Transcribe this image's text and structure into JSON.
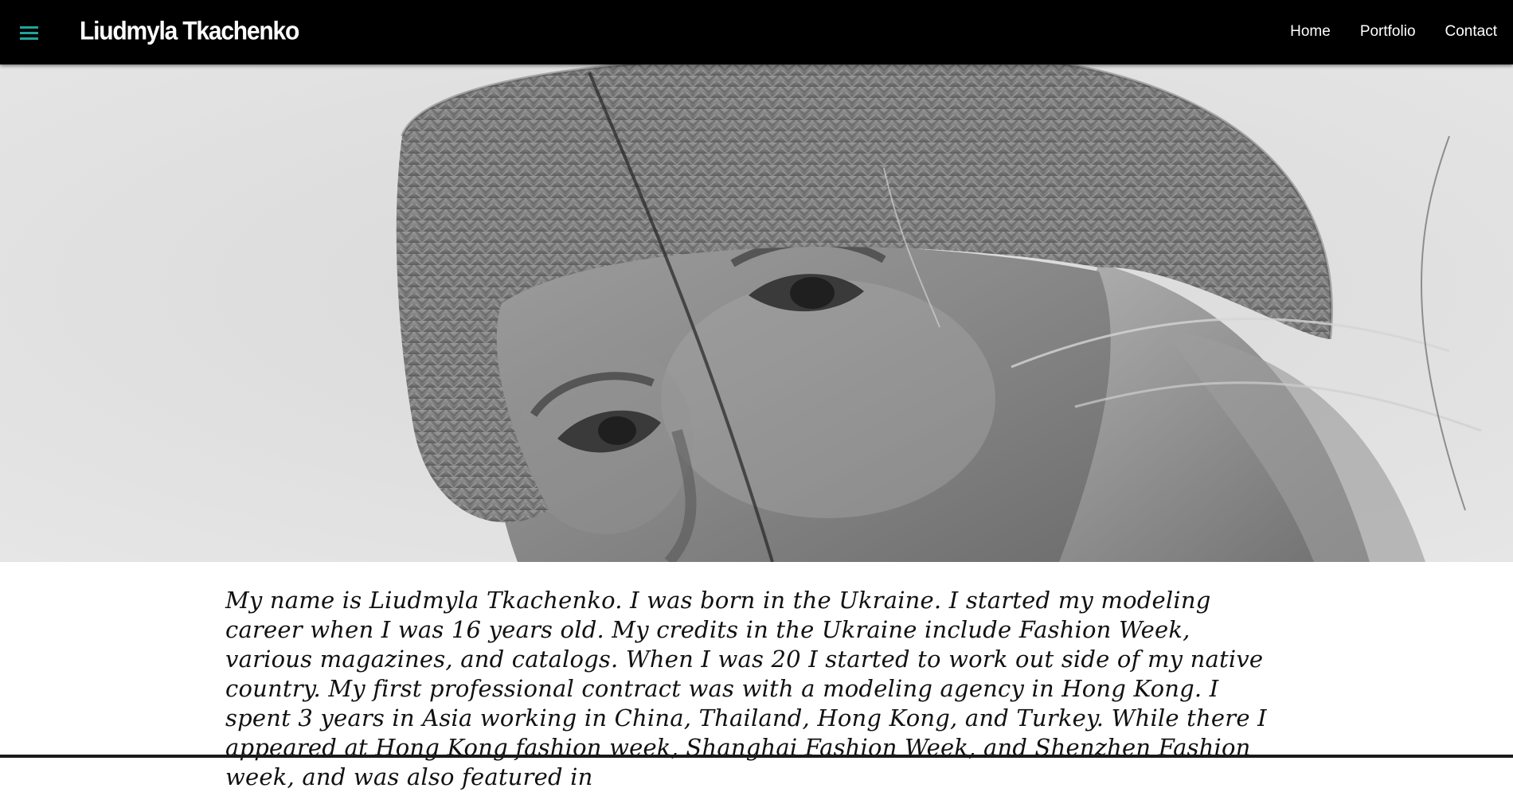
{
  "header": {
    "menu_icon": "hamburger-menu-icon",
    "brand": "Liudmyla Tkachenko",
    "nav": [
      {
        "label": "Home"
      },
      {
        "label": "Portfolio"
      },
      {
        "label": "Contact"
      }
    ],
    "accent_color": "#1fa59a",
    "background_color": "#000000"
  },
  "hero": {
    "image_kind": "black-and-white portrait photo"
  },
  "bio": {
    "text": "My name is Liudmyla Tkachenko. I was born in the Ukraine. I started my modeling career when I was 16 years old. My credits in the Ukraine include Fashion Week, various magazines, and catalogs. When I was 20 I started to work out side of my native country. My first professional contract was with a modeling agency in Hong Kong. I spent 3 years in Asia working in China, Thailand, Hong Kong, and Turkey. While there I appeared at Hong Kong fashion week, Shanghai Fashion Week, and Shenzhen Fashion week, and was also featured in"
  }
}
